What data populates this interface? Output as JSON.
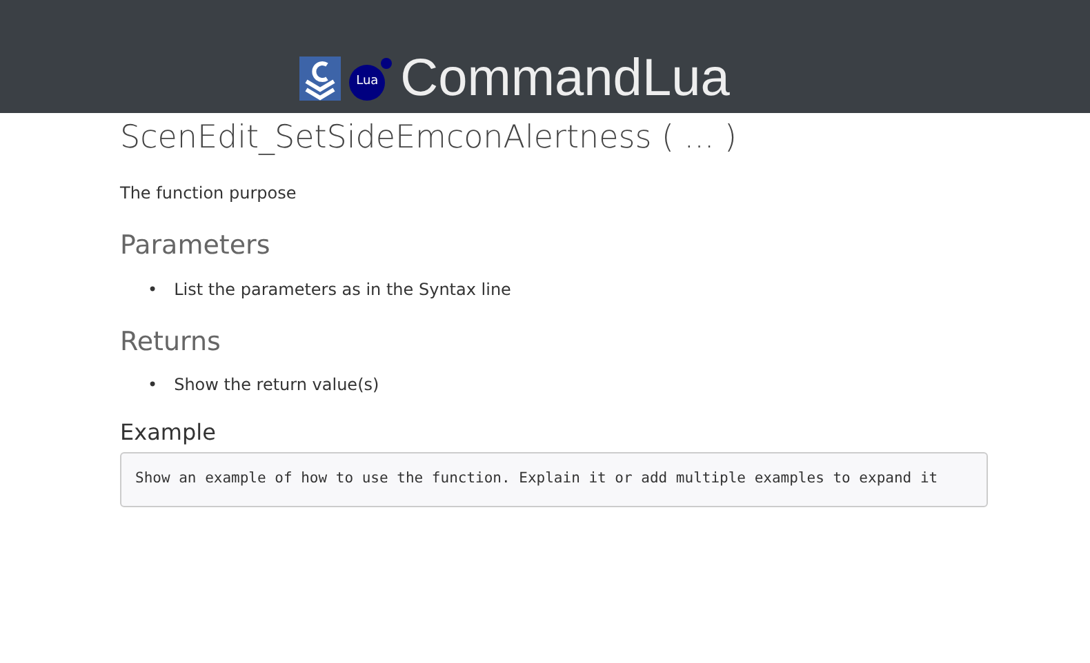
{
  "header": {
    "logo_text": "Lua",
    "brand": "CommandLua"
  },
  "title": "ScenEdit_SetSideEmconAlertness ( ... )",
  "purpose": "The function purpose",
  "sections": [
    {
      "heading": "Parameters",
      "items": [
        {
          "bullet": "•",
          "text": "List the parameters as in the Syntax line"
        }
      ]
    },
    {
      "heading": "Returns",
      "items": [
        {
          "bullet": "•",
          "text": "Show the return value(s)"
        }
      ]
    }
  ],
  "example": {
    "heading": "Example",
    "code": "Show an example of how to use the function. Explain it or add multiple examples to expand it"
  }
}
